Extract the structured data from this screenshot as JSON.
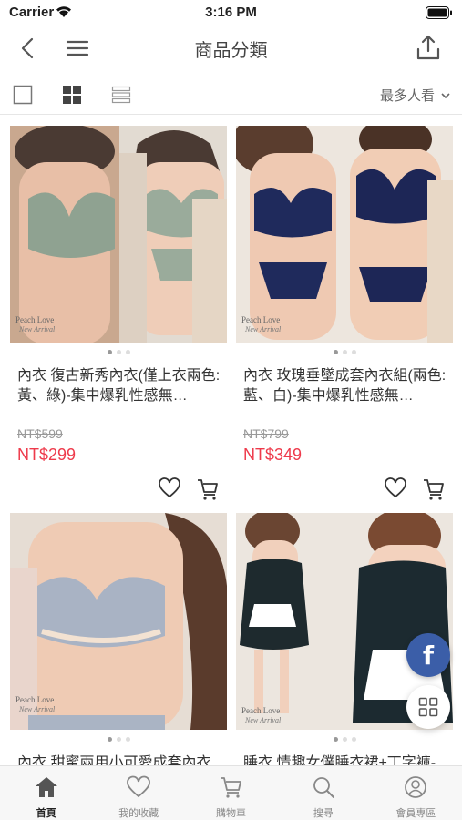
{
  "status_bar": {
    "carrier": "Carrier",
    "time": "3:16 PM"
  },
  "nav": {
    "title": "商品分類"
  },
  "toolbar": {
    "sort_label": "最多人看"
  },
  "products": [
    {
      "name": "內衣 復古新秀內衣(僅上衣兩色:黃、綠)-集中爆乳性感無…",
      "old_price": "NT$599",
      "price": "NT$299",
      "photo_caption": "Peach Love",
      "photo_sub": "New Arrival"
    },
    {
      "name": "內衣 玫瑰垂墜成套內衣組(兩色:藍、白)-集中爆乳性感無…",
      "old_price": "NT$799",
      "price": "NT$349",
      "photo_caption": "Peach Love",
      "photo_sub": "New Arrival"
    },
    {
      "name": "內衣 甜蜜兩用小可愛成套內衣",
      "old_price": "",
      "price": "",
      "photo_caption": "Peach Love",
      "photo_sub": "New Arrival"
    },
    {
      "name": "睡衣 情趣女僕睡衣裙+丁字褲-",
      "old_price": "",
      "price": "",
      "photo_caption": "Peach Love",
      "photo_sub": "New Arrival"
    }
  ],
  "tabs": [
    {
      "label": "首頁",
      "icon": "home-icon",
      "active": true
    },
    {
      "label": "我的收藏",
      "icon": "heart-icon",
      "active": false
    },
    {
      "label": "購物車",
      "icon": "cart-icon",
      "active": false
    },
    {
      "label": "搜尋",
      "icon": "search-icon",
      "active": false
    },
    {
      "label": "會員專區",
      "icon": "user-icon",
      "active": false
    }
  ],
  "colors": {
    "price_red": "#ee3a4b",
    "facebook_blue": "#3b5ea8",
    "icon_gray": "#555555"
  }
}
